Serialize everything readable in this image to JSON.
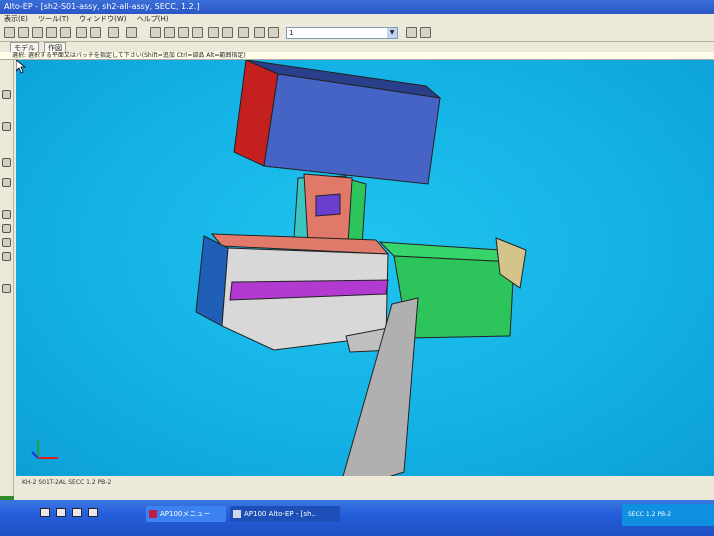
{
  "window": {
    "title": "Alto-EP - [sh2-S01-assy, sh2-all-assy, SECC, 1.2.]"
  },
  "menu": {
    "items": [
      "表示(E)",
      "ツール(T)",
      "ウィンドウ(W)",
      "ヘルプ(H)"
    ]
  },
  "toolbar": {
    "combo_value": "1"
  },
  "tabs": {
    "model_label": "モデル",
    "drawing_label": "作図"
  },
  "prompt": {
    "text": "選択: 選択する平面又はパッチを指定して下さい(Shift=追加 Ctrl=部品 Alt=範囲指定)"
  },
  "status": {
    "text": "KH-2 S01T-2AL SECC 1.2 PB-2"
  },
  "taskbar": {
    "task1_label": "AP100メニュー",
    "task2_label": "AP100 Alto-EP - [sh..",
    "tray_text": "SECC 1.2 PB-2"
  },
  "colors": {
    "viewport_bg": "#14b2e6",
    "box_front": "#3e5fc0",
    "box_side": "#c42020",
    "green_part": "#2ec45c",
    "grey_part": "#d6d6d6",
    "blue_side": "#1f5fb8",
    "magenta_part": "#b23ad0",
    "salmon_part": "#e07a6a",
    "taskbar": "#245edb"
  }
}
